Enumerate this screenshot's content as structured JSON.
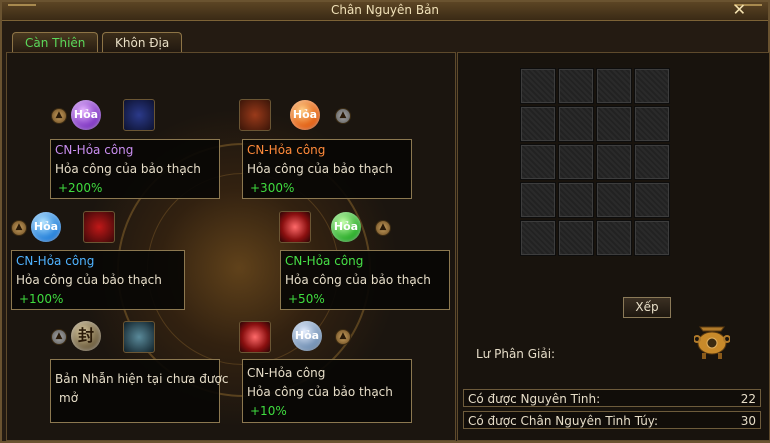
{
  "window": {
    "title": "Chân Nguyên Bản"
  },
  "tabs": [
    {
      "label": "Càn Thiên",
      "active": true
    },
    {
      "label": "Khôn Địa",
      "active": false
    }
  ],
  "boxes": [
    {
      "title": "CN-Hỏa công",
      "desc": "Hỏa công của bảo thạch",
      "bonus": "+200%",
      "title_color": "#c98ef0"
    },
    {
      "title": "CN-Hỏa công",
      "desc": "Hỏa công của bảo thạch",
      "bonus": "+300%",
      "title_color": "#ff8a3a"
    },
    {
      "title": "CN-Hỏa công",
      "desc": "Hỏa công của bảo thạch",
      "bonus": "+100%",
      "title_color": "#4fb3ff"
    },
    {
      "title": "CN-Hỏa công",
      "desc": "Hỏa công của bảo thạch",
      "bonus": "+50%",
      "title_color": "#46e046"
    },
    {
      "line1": "Bản Nhẫn hiện tại chưa được",
      "line2": "mở"
    },
    {
      "title": "CN-Hỏa công",
      "desc": "Hỏa công của bảo thạch",
      "bonus": "+10%",
      "title_color": "#e6ddc8"
    }
  ],
  "orbs": {
    "label": "Hỏa",
    "seal": "封"
  },
  "inventory": {
    "sort_label": "Xếp",
    "rows": 5,
    "cols": 4
  },
  "decompose_label": "Lư Phân Giải:",
  "stats": [
    {
      "label": "Có được Nguyên Tinh:",
      "value": "22"
    },
    {
      "label": "Có được Chân Nguyên Tinh Túy:",
      "value": "30"
    }
  ],
  "colors": {
    "gold": "#a88a4f",
    "green": "#3fdc3f",
    "frame": "#6a5330"
  }
}
